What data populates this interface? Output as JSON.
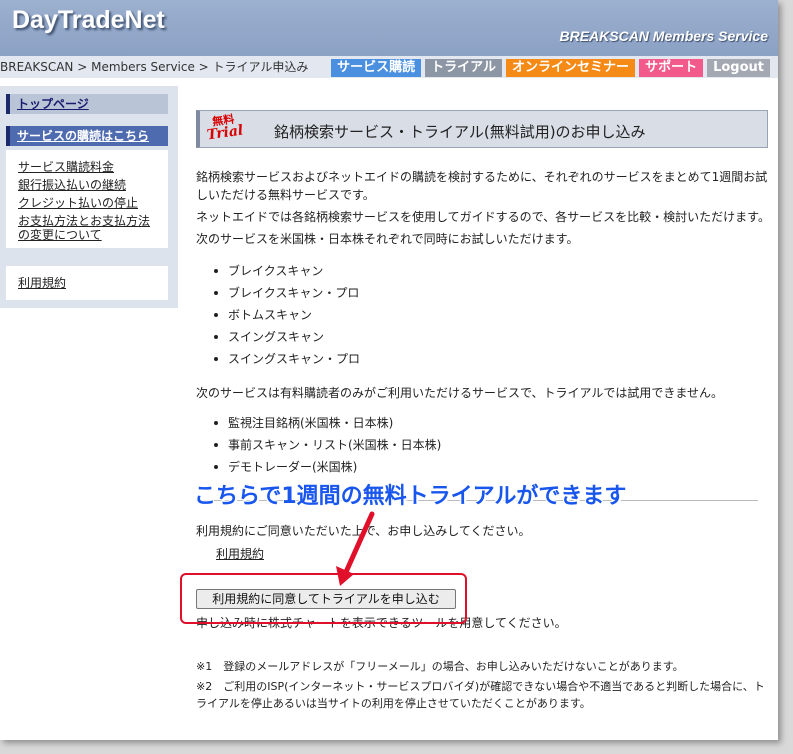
{
  "header": {
    "logo": "DayTradeNet",
    "members": "BREAKSCAN Members Service"
  },
  "breadcrumb": "BREAKSCAN > Members Service > トライアル申込み",
  "topnav": [
    {
      "label": "サービス購読",
      "color": "#4a8fe0"
    },
    {
      "label": "トライアル",
      "color": "#8d96a4"
    },
    {
      "label": "オンラインセミナー",
      "color": "#f58a16"
    },
    {
      "label": "サポート",
      "color": "#f25a8c"
    },
    {
      "label": "Logout",
      "color": "#a3a8b2"
    }
  ],
  "sidebar": {
    "top": "トップページ",
    "active": "サービスの購読はこちら",
    "links": [
      "サービス購読料金",
      "銀行振込払いの継続",
      "クレジット払いの停止",
      "お支払方法とお支払方法の変更について"
    ],
    "terms": "利用規約"
  },
  "main": {
    "badge_a": "無料",
    "badge_b": "Trial",
    "title": "銘柄検索サービス・トライアル(無料試用)のお申し込み",
    "intro1": "銘柄検索サービスおよびネットエイドの購読を検討するために、それぞれのサービスをまとめて1週間お試しいただける無料サービスです。",
    "intro2": "ネットエイドでは各銘柄検索サービスを使用してガイドするので、各サービスを比較・検討いただけます。",
    "intro3": "次のサービスを米国株・日本株それぞれで同時にお試しいただけます。",
    "services": [
      "ブレイクスキャン",
      "ブレイクスキャン・プロ",
      "ボトムスキャン",
      "スイングスキャン",
      "スイングスキャン・プロ"
    ],
    "paid_intro": "次のサービスは有料購読者のみがご利用いただけるサービスで、トライアルでは試用できません。",
    "paid_services": [
      "監視注目銘柄(米国株・日本株)",
      "事前スキャン・リスト(米国株・日本株)",
      "デモトレーダー(米国株)"
    ],
    "agree_text": "利用規約にご同意いただいた上で、お申し込みしてください。",
    "terms_link": "利用規約",
    "agree_button": "利用規約に同意してトライアルを申し込む",
    "tool_note": "申し込み時に株式チャートを表示できるツールを用意してください。",
    "note1": "※1　登録のメールアドレスが「フリーメール」の場合、お申し込みいただけないことがあります。",
    "note2": "※2　ご利用のISP(インターネット・サービスプロバイダ)が確認できない場合や不適当であると判断した場合に、トライアルを停止あるいは当サイトの利用を停止させていただくことがあります。"
  },
  "annotation": {
    "callout": "こちらで1週間の無料トライアルができます",
    "callout_color": "#1856ee",
    "box_color": "#e0102a"
  }
}
